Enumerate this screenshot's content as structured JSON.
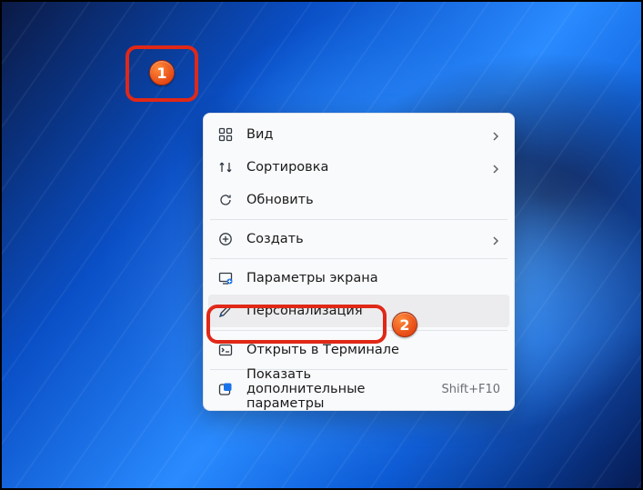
{
  "menu": {
    "view": {
      "label": "Вид"
    },
    "sort": {
      "label": "Сортировка"
    },
    "refresh": {
      "label": "Обновить"
    },
    "new": {
      "label": "Создать"
    },
    "display": {
      "label": "Параметры экрана"
    },
    "personalize": {
      "label": "Персонализация"
    },
    "terminal": {
      "label": "Открыть в Терминале"
    },
    "more": {
      "label": "Показать дополнительные параметры",
      "shortcut": "Shift+F10"
    }
  },
  "annotations": {
    "badge1": "1",
    "badge2": "2"
  }
}
